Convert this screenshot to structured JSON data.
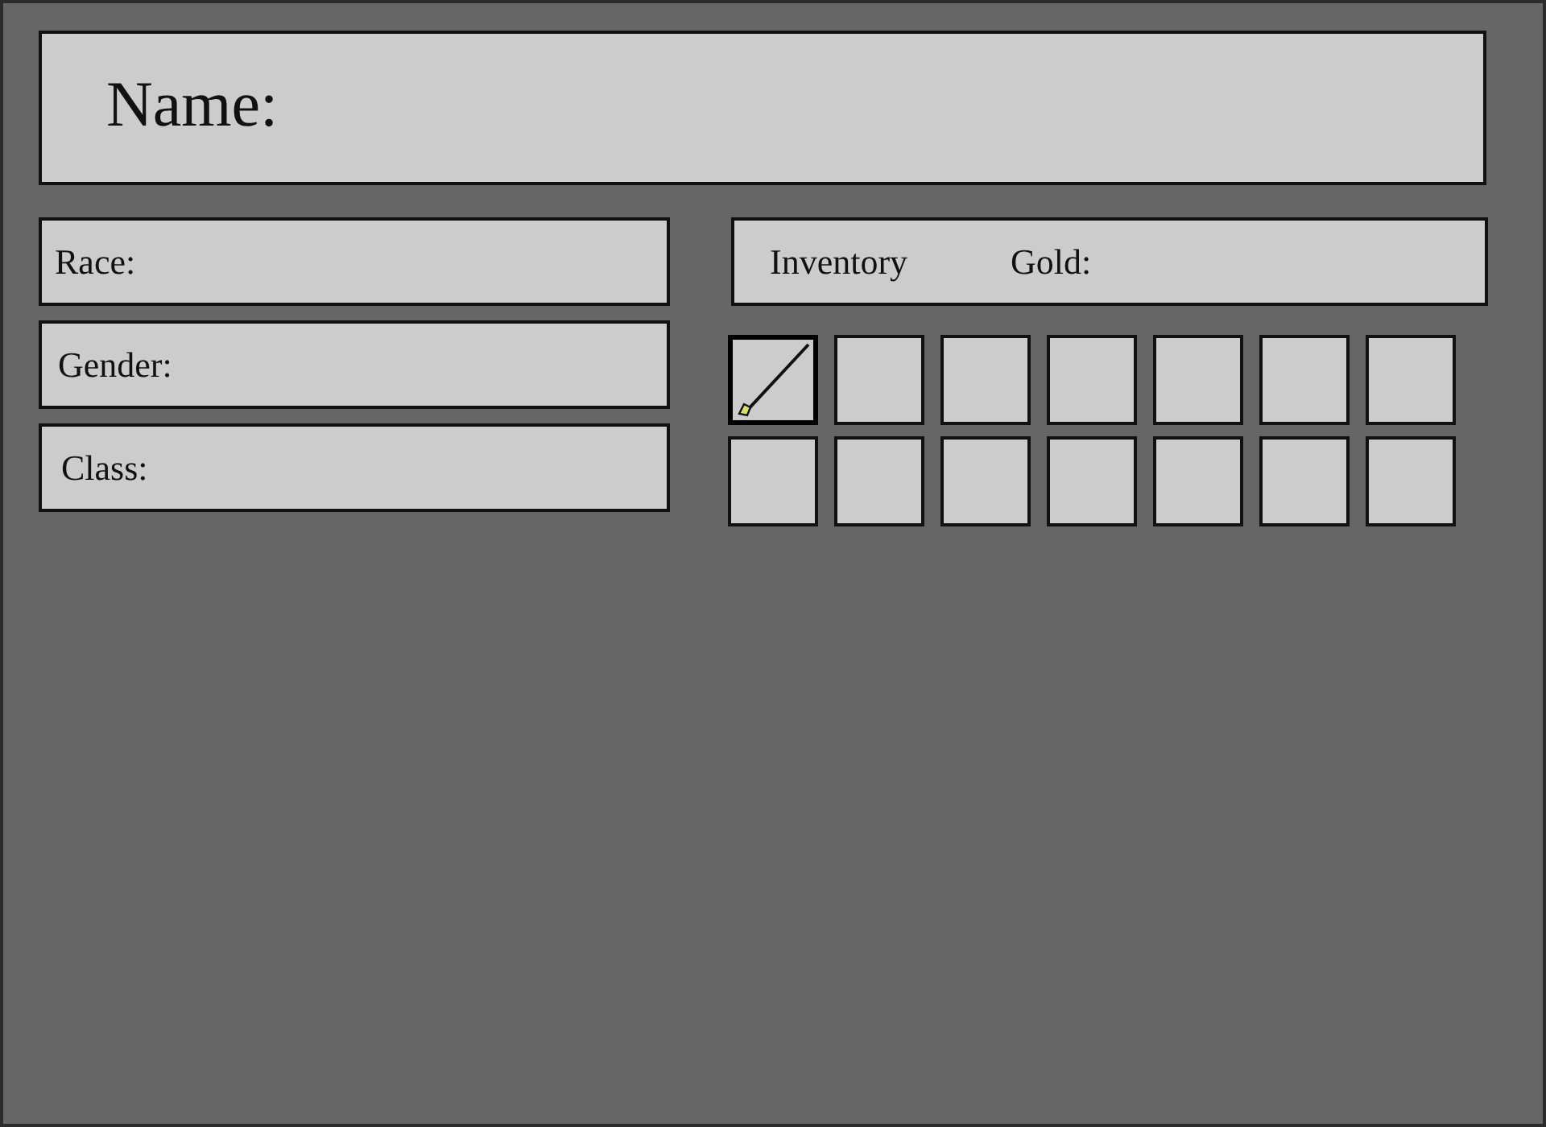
{
  "name_panel": {
    "label": "Name:"
  },
  "details": [
    {
      "label": "Race:"
    },
    {
      "label": "Gender:"
    },
    {
      "label": "Class:"
    }
  ],
  "inventory": {
    "title": "Inventory",
    "gold_label": "Gold:"
  },
  "slots": [
    {
      "kind": "staff",
      "selected": true
    },
    {
      "kind": "empty",
      "selected": false
    },
    {
      "kind": "empty",
      "selected": false
    },
    {
      "kind": "empty",
      "selected": false
    },
    {
      "kind": "empty",
      "selected": false
    },
    {
      "kind": "empty",
      "selected": false
    },
    {
      "kind": "empty",
      "selected": false
    },
    {
      "kind": "empty",
      "selected": false
    },
    {
      "kind": "empty",
      "selected": false
    },
    {
      "kind": "empty",
      "selected": false
    },
    {
      "kind": "empty",
      "selected": false
    },
    {
      "kind": "empty",
      "selected": false
    },
    {
      "kind": "empty",
      "selected": false
    },
    {
      "kind": "empty",
      "selected": false
    }
  ]
}
